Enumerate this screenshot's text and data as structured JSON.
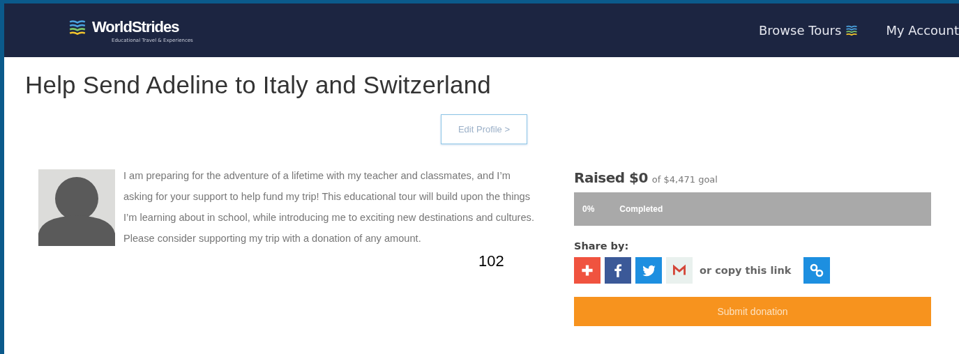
{
  "header": {
    "logo": {
      "name": "WorldStrides",
      "tagline": "Educational Travel & Experiences"
    },
    "nav": [
      {
        "label": "Browse Tours",
        "kind": "menu"
      },
      {
        "label": "My Account",
        "kind": "link"
      }
    ]
  },
  "title": "Help Send Adeline to Italy and Switzerland",
  "edit_profile": "Edit Profile >",
  "story": "I am preparing for the adventure of a lifetime with my teacher and classmates, and I’m asking for your support to help fund my trip! This educational tour will build upon the things I’m learning about in school, while introducing me to exciting new destinations and cultures. Please consider supporting my trip with a donation of any amount.",
  "fundraising": {
    "raised_label": "Raised $0",
    "goal": "of $4,471 goal",
    "progress": {
      "level": 0,
      "percent": "0%",
      "label": "Completed"
    },
    "share_label": "Share by:",
    "share_buttons": [
      {
        "kind": "plus"
      },
      {
        "kind": "facebook"
      },
      {
        "kind": "twitter"
      },
      {
        "kind": "gmail"
      }
    ],
    "copy_link": "or copy this link",
    "donate_button": "Submit donation"
  },
  "page_number": "102"
}
